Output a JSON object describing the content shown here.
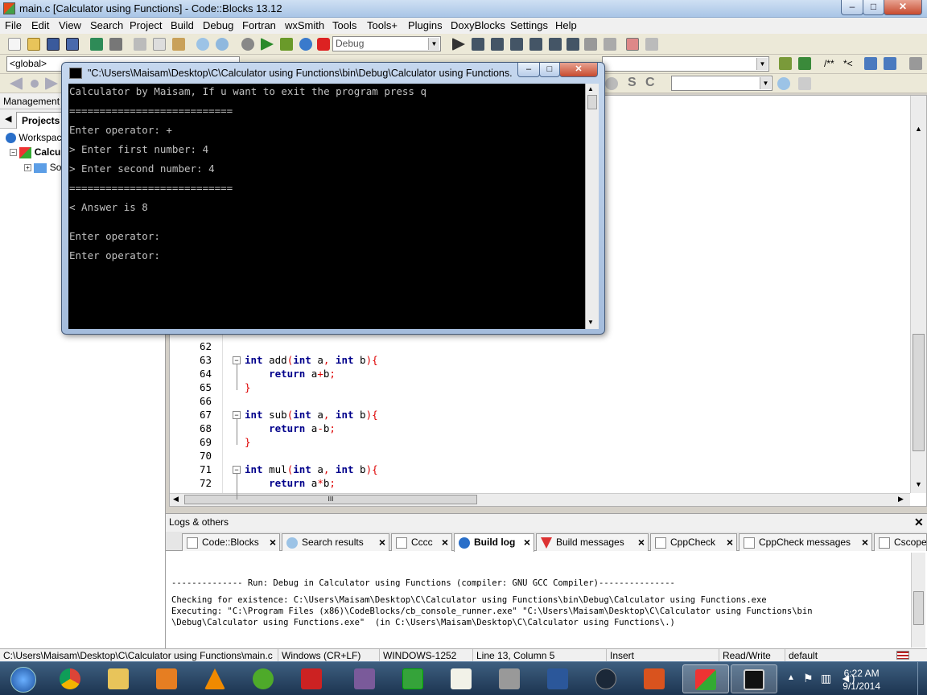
{
  "window": {
    "title": "main.c [Calculator using Functions] - Code::Blocks 13.12",
    "minimize": "–",
    "maximize": "□",
    "close": "✕"
  },
  "menu": [
    "File",
    "Edit",
    "View",
    "Search",
    "Project",
    "Build",
    "Debug",
    "Fortran",
    "wxSmith",
    "Tools",
    "Tools+",
    "Plugins",
    "DoxyBlocks",
    "Settings",
    "Help"
  ],
  "toolbar": {
    "build_target": "Debug",
    "scope": "<global>",
    "doxy_block": "/**",
    "doxy_line": "*<"
  },
  "management": {
    "title": "Management",
    "tab": "Projects",
    "tree": [
      "Workspace",
      "Calculator using Functions",
      "Sources"
    ]
  },
  "editor": {
    "lines": [
      {
        "n": "62",
        "text": ""
      },
      {
        "n": "63",
        "text": "int add(int a, int b){"
      },
      {
        "n": "64",
        "text": "    return a+b;"
      },
      {
        "n": "65",
        "text": "}"
      },
      {
        "n": "66",
        "text": ""
      },
      {
        "n": "67",
        "text": "int sub(int a, int b){"
      },
      {
        "n": "68",
        "text": "    return a-b;"
      },
      {
        "n": "69",
        "text": "}"
      },
      {
        "n": "70",
        "text": ""
      },
      {
        "n": "71",
        "text": "int mul(int a, int b){"
      },
      {
        "n": "72",
        "text": "    return a*b;"
      }
    ],
    "hscroll_marker": "III"
  },
  "console": {
    "title": "\"C:\\Users\\Maisam\\Desktop\\C\\Calculator using Functions\\bin\\Debug\\Calculator using Functions.exe\"",
    "lines": [
      "Calculator by Maisam, If u want to exit the program press q",
      "===========================",
      "Enter operator: +",
      "> Enter first number: 4",
      "> Enter second number: 4",
      "===========================",
      "< Answer is 8",
      "Enter operator:",
      "Enter operator:"
    ]
  },
  "logs": {
    "title": "Logs & others",
    "tabs": [
      "Code::Blocks",
      "Search results",
      "Cccc",
      "Build log",
      "Build messages",
      "CppCheck",
      "CppCheck messages",
      "Cscope"
    ],
    "active_tab": "Build log",
    "lines": [
      "-------------- Run: Debug in Calculator using Functions (compiler: GNU GCC Compiler)---------------",
      "Checking for existence: C:\\Users\\Maisam\\Desktop\\C\\Calculator using Functions\\bin\\Debug\\Calculator using Functions.exe",
      "Executing: \"C:\\Program Files (x86)\\CodeBlocks/cb_console_runner.exe\" \"C:\\Users\\Maisam\\Desktop\\C\\Calculator using Functions\\bin",
      "\\Debug\\Calculator using Functions.exe\"  (in C:\\Users\\Maisam\\Desktop\\C\\Calculator using Functions\\.)"
    ]
  },
  "status": {
    "file": "C:\\Users\\Maisam\\Desktop\\C\\Calculator using Functions\\main.c",
    "eol": "Windows (CR+LF)",
    "encoding": "WINDOWS-1252",
    "position": "Line 13, Column 5",
    "mode": "Insert",
    "access": "Read/Write",
    "lang": "default"
  },
  "taskbar": {
    "apps": [
      "start",
      "chrome",
      "explorer",
      "media-player",
      "vlc",
      "utorrent",
      "nfs",
      "winrar",
      "dreamweaver",
      "notepad-plus-plus",
      "toolbox",
      "word",
      "steam",
      "ms-office",
      "codeblocks",
      "console"
    ],
    "time": "6:22 AM",
    "date": "9/1/2014"
  },
  "colors": {
    "keyword": "#00008b",
    "operator": "#dd0000",
    "console_bg": "#000000",
    "console_fg": "#c0c0c0"
  }
}
